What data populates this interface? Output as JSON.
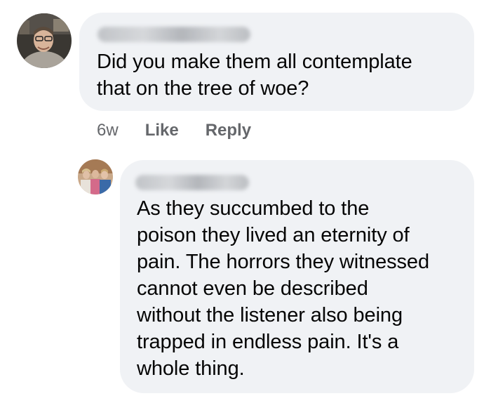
{
  "comments": [
    {
      "avatar_icon": "user-photo-icon",
      "author": "",
      "text": "Did you make them all contemplate\nthat on the tree of woe?",
      "time": "6w",
      "like_label": "Like",
      "reply_label": "Reply"
    },
    {
      "avatar_icon": "group-photo-icon",
      "author": "",
      "text": "As they succumbed to the\npoison they lived an eternity of\npain. The horrors they witnessed\ncannot even be described\nwithout the listener also being\ntrapped in endless pain. It's a\nwhole thing."
    }
  ],
  "colors": {
    "bubble": "#f0f2f5",
    "text": "#050505",
    "meta": "#65676b"
  }
}
